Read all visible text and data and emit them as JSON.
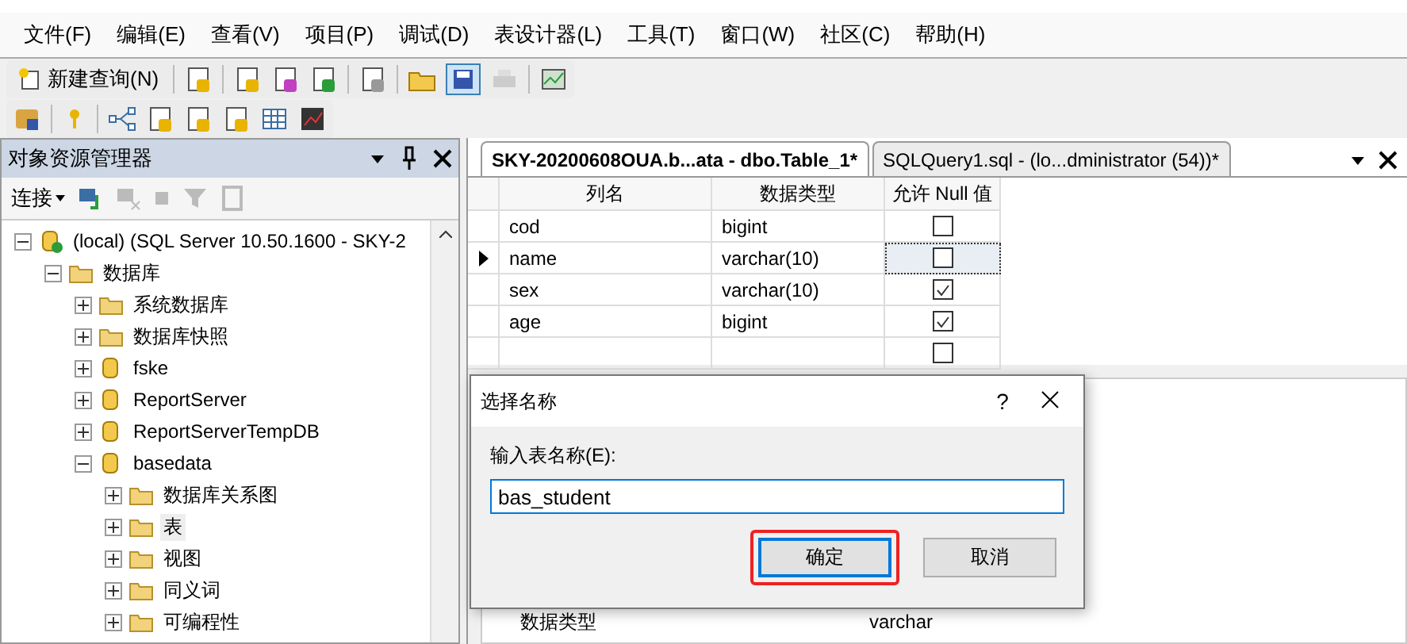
{
  "menu": [
    "文件(F)",
    "编辑(E)",
    "查看(V)",
    "项目(P)",
    "调试(D)",
    "表设计器(L)",
    "工具(T)",
    "窗口(W)",
    "社区(C)",
    "帮助(H)"
  ],
  "toolbar": {
    "new_query": "新建查询(N)"
  },
  "explorer": {
    "title": "对象资源管理器",
    "connect": "连接",
    "tree": [
      {
        "label": "(local) (SQL Server 10.50.1600 - SKY-2",
        "kind": "server",
        "expanded": true,
        "children": [
          {
            "label": "数据库",
            "kind": "folder",
            "expanded": true,
            "children": [
              {
                "label": "系统数据库",
                "kind": "folder",
                "expanded": false
              },
              {
                "label": "数据库快照",
                "kind": "folder",
                "expanded": false
              },
              {
                "label": "fske",
                "kind": "database",
                "expanded": false
              },
              {
                "label": "ReportServer",
                "kind": "database",
                "expanded": false
              },
              {
                "label": "ReportServerTempDB",
                "kind": "database",
                "expanded": false
              },
              {
                "label": "basedata",
                "kind": "database",
                "expanded": true,
                "children": [
                  {
                    "label": "数据库关系图",
                    "kind": "folder",
                    "expanded": false
                  },
                  {
                    "label": "表",
                    "kind": "folder",
                    "expanded": false,
                    "selected": true
                  },
                  {
                    "label": "视图",
                    "kind": "folder",
                    "expanded": false
                  },
                  {
                    "label": "同义词",
                    "kind": "folder",
                    "expanded": false
                  },
                  {
                    "label": "可编程性",
                    "kind": "folder",
                    "expanded": false
                  }
                ]
              }
            ]
          }
        ]
      }
    ]
  },
  "tabs": [
    {
      "label": "SKY-20200608OUA.b...ata - dbo.Table_1*",
      "selected": true
    },
    {
      "label": "SQLQuery1.sql - (lo...dministrator (54))*",
      "selected": false
    }
  ],
  "table": {
    "columns": [
      "列名",
      "数据类型",
      "允许 Null 值"
    ],
    "rows": [
      {
        "name": "cod",
        "type": "bigint",
        "allow_null": false,
        "current": false
      },
      {
        "name": "name",
        "type": "varchar(10)",
        "allow_null": false,
        "current": true
      },
      {
        "name": "sex",
        "type": "varchar(10)",
        "allow_null": true,
        "current": false
      },
      {
        "name": "age",
        "type": "bigint",
        "allow_null": true,
        "current": false
      },
      {
        "allow_null": false,
        "current": false
      }
    ]
  },
  "properties": {
    "rows": [
      {
        "label": "数据类型",
        "value": "varchar"
      }
    ]
  },
  "dialog": {
    "title": "选择名称",
    "help": "?",
    "prompt": "输入表名称(E):",
    "value": "bas_student",
    "buttons": [
      {
        "label": "确定",
        "default": true,
        "highlighted": true
      },
      {
        "label": "取消",
        "default": false,
        "highlighted": false
      }
    ]
  }
}
